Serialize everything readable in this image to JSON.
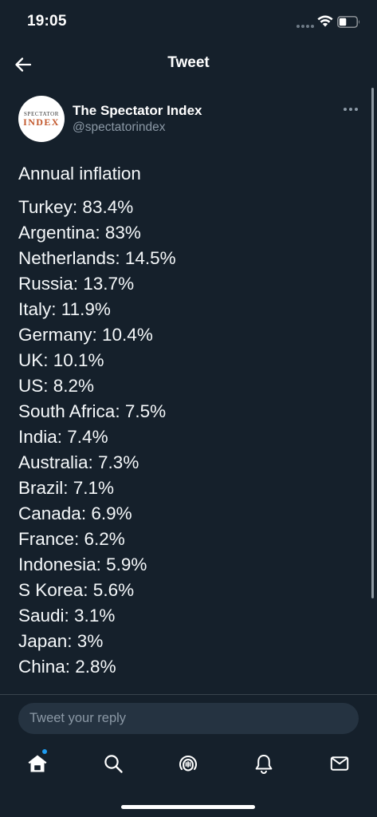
{
  "status_bar": {
    "time": "19:05"
  },
  "header": {
    "title": "Tweet"
  },
  "author": {
    "avatar_text_top": "SPECTATOR",
    "avatar_text_bottom": "INDEX",
    "name": "The Spectator Index",
    "handle": "@spectatorindex"
  },
  "tweet": {
    "heading": "Annual inflation",
    "lines": [
      "Turkey: 83.4%",
      "Argentina: 83%",
      "Netherlands: 14.5%",
      "Russia: 13.7%",
      "Italy: 11.9%",
      "Germany: 10.4%",
      "UK: 10.1%",
      "US: 8.2%",
      "South Africa: 7.5%",
      "India: 7.4%",
      "Australia: 7.3%",
      "Brazil: 7.1%",
      "Canada: 6.9%",
      "France: 6.2%",
      "Indonesia: 5.9%",
      "S Korea: 5.6%",
      "Saudi: 3.1%",
      "Japan: 3%",
      "China: 2.8%"
    ]
  },
  "reply": {
    "placeholder": "Tweet your reply"
  },
  "tab_bar": {
    "tabs": [
      {
        "icon": "home-icon",
        "active": true
      },
      {
        "icon": "search-icon",
        "active": false
      },
      {
        "icon": "spaces-icon",
        "active": false
      },
      {
        "icon": "bell-icon",
        "active": false
      },
      {
        "icon": "mail-icon",
        "active": false
      }
    ]
  },
  "colors": {
    "background": "#15202b",
    "text_primary": "#ffffff",
    "text_secondary": "#8b98a5",
    "accent": "#1d9bf0",
    "input_background": "#253341"
  }
}
